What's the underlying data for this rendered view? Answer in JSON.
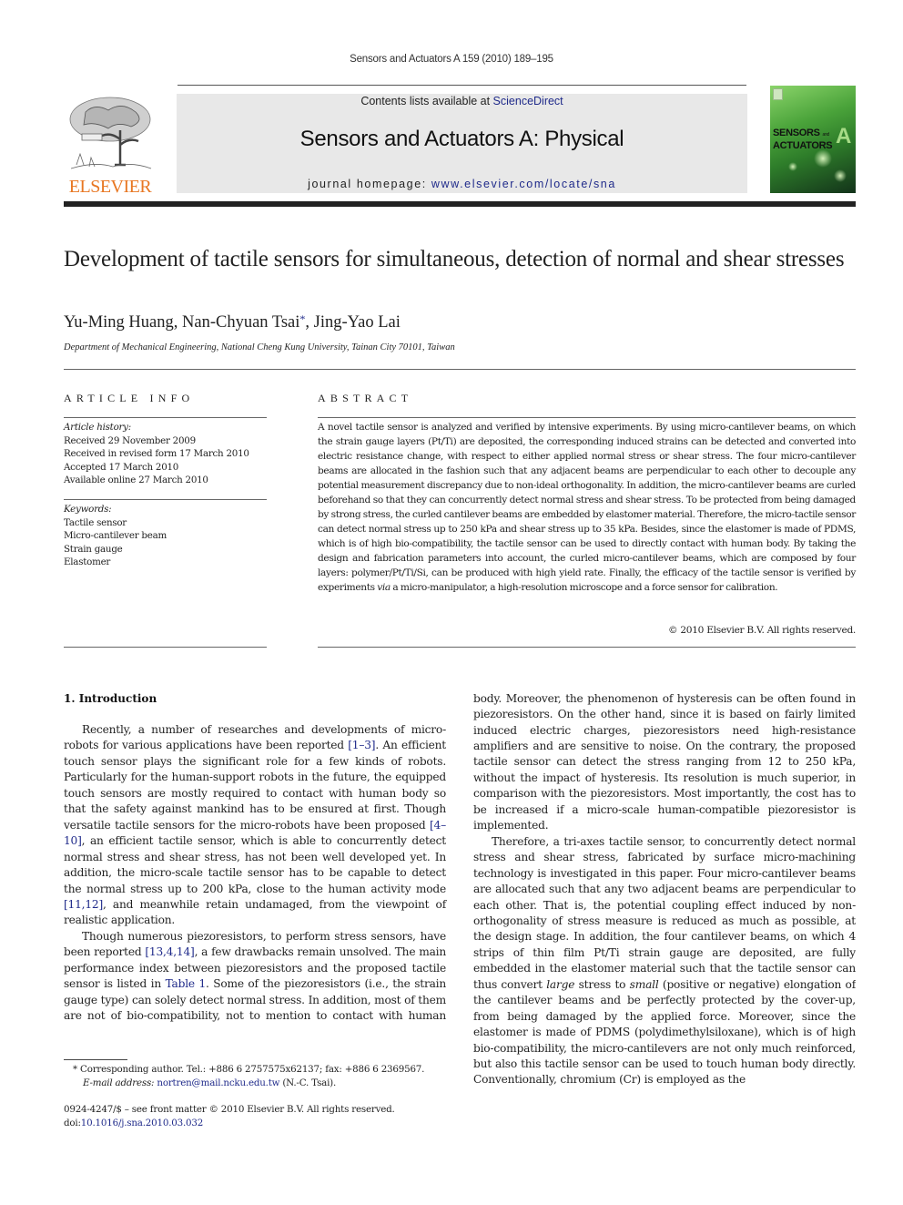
{
  "running_head": "Sensors and Actuators A 159 (2010) 189–195",
  "publisher_logo": {
    "name": "ELSEVIER",
    "color": "#e87722"
  },
  "journal_box": {
    "contents_prefix": "Contents lists available at ",
    "contents_link": "ScienceDirect",
    "journal_title": "Sensors and Actuators A: Physical",
    "homepage_prefix": "journal homepage: ",
    "homepage_link": "www.elsevier.com/locate/sna"
  },
  "cover": {
    "line1": "SENSORS",
    "and": "and",
    "line2": "ACTUATORS",
    "letter": "A"
  },
  "article": {
    "title": "Development of tactile sensors for simultaneous, detection of normal and shear stresses",
    "authors": [
      {
        "name": "Yu-Ming Huang",
        "sep": ", "
      },
      {
        "name": "Nan-Chyuan Tsai",
        "mark": "*",
        "sep": ", "
      },
      {
        "name": "Jing-Yao Lai",
        "sep": ""
      }
    ],
    "affiliation": "Department of Mechanical Engineering, National Cheng Kung University, Tainan City 70101, Taiwan"
  },
  "article_info": {
    "heading": "ARTICLE INFO",
    "history_label": "Article history:",
    "history": [
      "Received 29 November 2009",
      "Received in revised form 17 March 2010",
      "Accepted 17 March 2010",
      "Available online 27 March 2010"
    ],
    "keywords_label": "Keywords:",
    "keywords": [
      "Tactile sensor",
      "Micro-cantilever beam",
      "Strain gauge",
      "Elastomer"
    ]
  },
  "abstract": {
    "heading": "ABSTRACT",
    "text_before_via": "A novel tactile sensor is analyzed and verified by intensive experiments. By using micro-cantilever beams, on which the strain gauge layers (Pt/Ti) are deposited, the corresponding induced strains can be detected and converted into electric resistance change, with respect to either applied normal stress or shear stress. The four micro-cantilever beams are allocated in the fashion such that any adjacent beams are perpendicular to each other to decouple any potential measurement discrepancy due to non-ideal orthogonality. In addition, the micro-cantilever beams are curled beforehand so that they can concurrently detect normal stress and shear stress. To be protected from being damaged by strong stress, the curled cantilever beams are embedded by elastomer material. Therefore, the micro-tactile sensor can detect normal stress up to 250 kPa and shear stress up to 35 kPa. Besides, since the elastomer is made of PDMS, which is of high bio-compatibility, the tactile sensor can be used to directly contact with human body. By taking the design and fabrication parameters into account, the curled micro-cantilever beams, which are composed by four layers: polymer/Pt/Ti/Si, can be produced with high yield rate. Finally, the efficacy of the tactile sensor is verified by experiments ",
    "via": "via",
    "text_after_via": " a micro-manipulator, a high-resolution microscope and a force sensor for calibration.",
    "copyright": "© 2010 Elsevier B.V. All rights reserved."
  },
  "introduction": {
    "heading": "1.  Introduction",
    "p1": {
      "a": "Recently, a number of researches and developments of micro-robots for various applications have been reported ",
      "ref1": "[1–3]",
      "b": ". An efficient touch sensor plays the significant role for a few kinds of robots. Particularly for the human-support robots in the future, the equipped touch sensors are mostly required to contact with human body so that the safety against mankind has to be ensured at first. Though versatile tactile sensors for the micro-robots have been proposed ",
      "ref2": "[4–10]",
      "c": ", an efficient tactile sensor, which is able to concurrently detect normal stress and shear stress, has not been well developed yet. In addition, the micro-scale tactile sensor has to be capable to detect the normal stress up to 200 kPa, close to the human activity mode ",
      "ref3": "[11,12]",
      "d": ", and meanwhile retain undamaged, from the viewpoint of realistic application."
    },
    "p2": {
      "a": "Though numerous piezoresistors, to perform stress sensors, have been reported ",
      "ref1": "[13,4,14]",
      "b": ", a few drawbacks remain unsolved. The main performance index between piezoresistors and the proposed tactile sensor is listed in ",
      "ref2": "Table 1",
      "c": ". Some of the piezoresistors (i.e., the strain gauge type) can solely detect normal stress. In addition, most of them are not of bio-compatibility, not to mention to contact with human body. Moreover, the phenomenon of hysteresis can be often found in piezoresistors. On the other hand, since it is based on fairly limited induced electric charges, piezoresistors need high-resistance amplifiers and are sensitive to noise. On the contrary, the proposed tactile sensor can detect the stress ranging from 12 to 250 kPa, without the impact of hysteresis. Its resolution is much superior, in comparison with the piezoresistors. Most importantly, the cost has to be increased if a micro-scale human-compatible piezoresistor is implemented."
    },
    "p3": {
      "a": "Therefore, a tri-axes tactile sensor, to concurrently detect normal stress and shear stress, fabricated by surface micro-machining technology is investigated in this paper. Four micro-cantilever beams are allocated such that any two adjacent beams are perpendicular to each other. That is, the potential coupling effect induced by non-orthogonality of stress measure is reduced as much as possible, at the design stage. In addition, the four cantilever beams, on which 4 strips of thin film Pt/Ti strain gauge are deposited, are fully embedded in the elastomer material such that the tactile sensor can thus convert ",
      "em1": "large",
      "b": " stress to ",
      "em2": "small",
      "c": " (positive or negative) elongation of the cantilever beams and be perfectly protected by the cover-up, from being damaged by the applied force. Moreover, since the elastomer is made of PDMS (polydimethylsiloxane), which is of high bio-compatibility, the micro-cantilevers are not only much reinforced, but also this tactile sensor can be used to touch human body directly. Conventionally, chromium (Cr) is employed as the"
    }
  },
  "footnote": {
    "mark": "*",
    "corresponding": "Corresponding author. Tel.: +886 6 2757575x62137; fax: +886 6 2369567.",
    "email_label": "E-mail address:",
    "email": "nortren@mail.ncku.edu.tw",
    "email_suffix": " (N.-C. Tsai)."
  },
  "front_matter": {
    "issn_line": "0924-4247/$ – see front matter © 2010 Elsevier B.V. All rights reserved.",
    "doi_prefix": "doi:",
    "doi": "10.1016/j.sna.2010.03.032"
  }
}
